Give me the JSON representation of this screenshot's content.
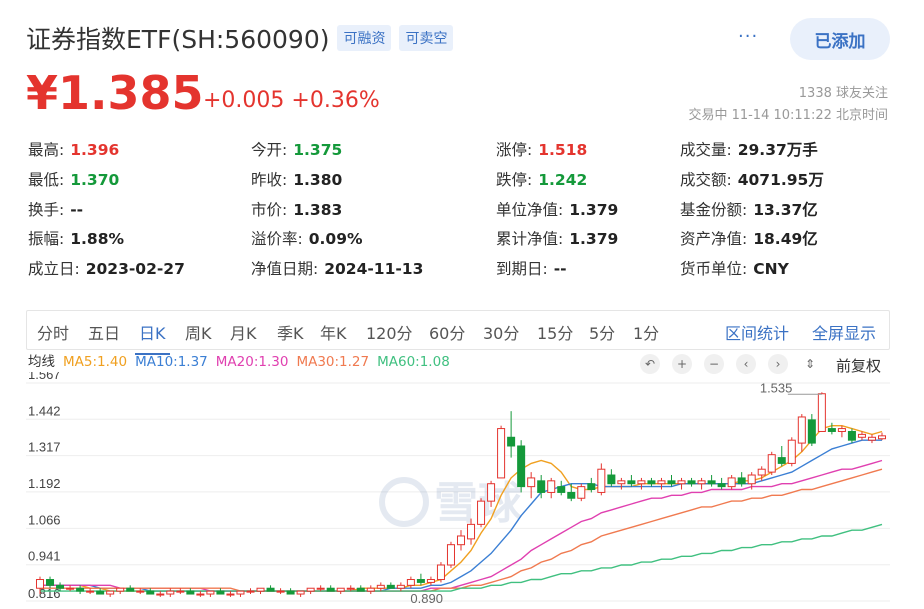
{
  "header": {
    "title": "证券指数ETF(SH:560090)",
    "tags": [
      "可融资",
      "可卖空"
    ],
    "more": "···",
    "added_label": "已添加"
  },
  "quote": {
    "price": "¥1.385",
    "change": "+0.005 +0.36%",
    "followers": "1338 球友关注",
    "trade_info": "交易中 11-14 10:11:22 北京时间"
  },
  "stats": [
    {
      "k": "最高:",
      "v": "1.396",
      "color": "red"
    },
    {
      "k": "今开:",
      "v": "1.375",
      "color": "green"
    },
    {
      "k": "涨停:",
      "v": "1.518",
      "color": "red"
    },
    {
      "k": "成交量:",
      "v": "29.37万手",
      "color": "dark"
    },
    {
      "k": "最低:",
      "v": "1.370",
      "color": "green"
    },
    {
      "k": "昨收:",
      "v": "1.380",
      "color": "dark"
    },
    {
      "k": "跌停:",
      "v": "1.242",
      "color": "green"
    },
    {
      "k": "成交额:",
      "v": "4071.95万",
      "color": "dark"
    },
    {
      "k": "换手:",
      "v": "--",
      "color": "dark"
    },
    {
      "k": "市价:",
      "v": "1.383",
      "color": "dark"
    },
    {
      "k": "单位净值:",
      "v": "1.379",
      "color": "dark"
    },
    {
      "k": "基金份额:",
      "v": "13.37亿",
      "color": "dark"
    },
    {
      "k": "振幅:",
      "v": "1.88%",
      "color": "dark"
    },
    {
      "k": "溢价率:",
      "v": "0.09%",
      "color": "dark"
    },
    {
      "k": "累计净值:",
      "v": "1.379",
      "color": "dark"
    },
    {
      "k": "资产净值:",
      "v": "18.49亿",
      "color": "dark"
    },
    {
      "k": "成立日:",
      "v": "2023-02-27",
      "color": "dark"
    },
    {
      "k": "净值日期:",
      "v": "2024-11-13",
      "color": "dark"
    },
    {
      "k": "到期日:",
      "v": "--",
      "color": "dark"
    },
    {
      "k": "货币单位:",
      "v": "CNY",
      "color": "dark"
    }
  ],
  "tabs": [
    "分时",
    "五日",
    "日K",
    "周K",
    "月K",
    "季K",
    "年K",
    "120分",
    "60分",
    "30分",
    "15分",
    "5分",
    "1分"
  ],
  "active_tab": "日K",
  "tab_links": [
    "区间统计",
    "全屏显示"
  ],
  "legend": [
    {
      "text": "均线",
      "color": "#333333"
    },
    {
      "text": "MA5:1.40",
      "color": "#f0a020"
    },
    {
      "text": "MA10:1.37",
      "color": "#3b7fd4"
    },
    {
      "text": "MA20:1.30",
      "color": "#e040b0"
    },
    {
      "text": "MA30:1.27",
      "color": "#f07a50"
    },
    {
      "text": "MA60:1.08",
      "color": "#40c080"
    }
  ],
  "controls": [
    "↶",
    "+",
    "−",
    "‹",
    "›",
    "⇕"
  ],
  "fuquan_label": "前复权",
  "watermark": "雪球",
  "chart_data": {
    "type": "candlestick",
    "y_ticks": [
      "1.567",
      "1.442",
      "1.317",
      "1.192",
      "1.066",
      "0.941",
      "0.816"
    ],
    "ylim": [
      0.816,
      1.567
    ],
    "annotations": [
      {
        "text": "1.535"
      },
      {
        "text": "0.890"
      }
    ],
    "candles": [
      {
        "o": 0.86,
        "h": 0.9,
        "l": 0.84,
        "c": 0.89
      },
      {
        "o": 0.89,
        "h": 0.9,
        "l": 0.86,
        "c": 0.87
      },
      {
        "o": 0.87,
        "h": 0.88,
        "l": 0.85,
        "c": 0.86
      },
      {
        "o": 0.86,
        "h": 0.87,
        "l": 0.85,
        "c": 0.86
      },
      {
        "o": 0.86,
        "h": 0.87,
        "l": 0.84,
        "c": 0.85
      },
      {
        "o": 0.85,
        "h": 0.86,
        "l": 0.84,
        "c": 0.85
      },
      {
        "o": 0.85,
        "h": 0.86,
        "l": 0.84,
        "c": 0.84
      },
      {
        "o": 0.84,
        "h": 0.85,
        "l": 0.83,
        "c": 0.85
      },
      {
        "o": 0.85,
        "h": 0.86,
        "l": 0.84,
        "c": 0.86
      },
      {
        "o": 0.86,
        "h": 0.87,
        "l": 0.85,
        "c": 0.85
      },
      {
        "o": 0.85,
        "h": 0.86,
        "l": 0.84,
        "c": 0.85
      },
      {
        "o": 0.85,
        "h": 0.86,
        "l": 0.84,
        "c": 0.84
      },
      {
        "o": 0.84,
        "h": 0.85,
        "l": 0.83,
        "c": 0.84
      },
      {
        "o": 0.84,
        "h": 0.86,
        "l": 0.83,
        "c": 0.85
      },
      {
        "o": 0.85,
        "h": 0.86,
        "l": 0.84,
        "c": 0.85
      },
      {
        "o": 0.85,
        "h": 0.86,
        "l": 0.84,
        "c": 0.84
      },
      {
        "o": 0.84,
        "h": 0.85,
        "l": 0.83,
        "c": 0.84
      },
      {
        "o": 0.84,
        "h": 0.85,
        "l": 0.83,
        "c": 0.85
      },
      {
        "o": 0.85,
        "h": 0.86,
        "l": 0.84,
        "c": 0.84
      },
      {
        "o": 0.84,
        "h": 0.85,
        "l": 0.83,
        "c": 0.84
      },
      {
        "o": 0.84,
        "h": 0.85,
        "l": 0.83,
        "c": 0.85
      },
      {
        "o": 0.85,
        "h": 0.86,
        "l": 0.84,
        "c": 0.85
      },
      {
        "o": 0.85,
        "h": 0.86,
        "l": 0.84,
        "c": 0.86
      },
      {
        "o": 0.86,
        "h": 0.87,
        "l": 0.85,
        "c": 0.85
      },
      {
        "o": 0.85,
        "h": 0.86,
        "l": 0.84,
        "c": 0.85
      },
      {
        "o": 0.85,
        "h": 0.86,
        "l": 0.84,
        "c": 0.84
      },
      {
        "o": 0.84,
        "h": 0.85,
        "l": 0.83,
        "c": 0.85
      },
      {
        "o": 0.85,
        "h": 0.86,
        "l": 0.84,
        "c": 0.86
      },
      {
        "o": 0.86,
        "h": 0.87,
        "l": 0.85,
        "c": 0.86
      },
      {
        "o": 0.86,
        "h": 0.87,
        "l": 0.85,
        "c": 0.85
      },
      {
        "o": 0.85,
        "h": 0.86,
        "l": 0.84,
        "c": 0.86
      },
      {
        "o": 0.86,
        "h": 0.87,
        "l": 0.85,
        "c": 0.86
      },
      {
        "o": 0.86,
        "h": 0.87,
        "l": 0.85,
        "c": 0.85
      },
      {
        "o": 0.85,
        "h": 0.87,
        "l": 0.84,
        "c": 0.86
      },
      {
        "o": 0.86,
        "h": 0.88,
        "l": 0.85,
        "c": 0.87
      },
      {
        "o": 0.87,
        "h": 0.88,
        "l": 0.86,
        "c": 0.86
      },
      {
        "o": 0.86,
        "h": 0.88,
        "l": 0.85,
        "c": 0.87
      },
      {
        "o": 0.87,
        "h": 0.9,
        "l": 0.86,
        "c": 0.89
      },
      {
        "o": 0.89,
        "h": 0.91,
        "l": 0.87,
        "c": 0.88
      },
      {
        "o": 0.88,
        "h": 0.9,
        "l": 0.87,
        "c": 0.89
      },
      {
        "o": 0.89,
        "h": 0.95,
        "l": 0.88,
        "c": 0.94
      },
      {
        "o": 0.94,
        "h": 1.02,
        "l": 0.93,
        "c": 1.01
      },
      {
        "o": 1.01,
        "h": 1.06,
        "l": 0.99,
        "c": 1.04
      },
      {
        "o": 1.03,
        "h": 1.1,
        "l": 1.01,
        "c": 1.08
      },
      {
        "o": 1.08,
        "h": 1.17,
        "l": 1.07,
        "c": 1.16
      },
      {
        "o": 1.16,
        "h": 1.23,
        "l": 1.14,
        "c": 1.22
      },
      {
        "o": 1.24,
        "h": 1.42,
        "l": 1.24,
        "c": 1.41
      },
      {
        "o": 1.38,
        "h": 1.47,
        "l": 1.31,
        "c": 1.35
      },
      {
        "o": 1.35,
        "h": 1.37,
        "l": 1.19,
        "c": 1.21
      },
      {
        "o": 1.21,
        "h": 1.26,
        "l": 1.17,
        "c": 1.24
      },
      {
        "o": 1.23,
        "h": 1.25,
        "l": 1.17,
        "c": 1.19
      },
      {
        "o": 1.19,
        "h": 1.24,
        "l": 1.17,
        "c": 1.23
      },
      {
        "o": 1.21,
        "h": 1.23,
        "l": 1.18,
        "c": 1.19
      },
      {
        "o": 1.19,
        "h": 1.22,
        "l": 1.16,
        "c": 1.17
      },
      {
        "o": 1.17,
        "h": 1.22,
        "l": 1.16,
        "c": 1.21
      },
      {
        "o": 1.22,
        "h": 1.24,
        "l": 1.19,
        "c": 1.2
      },
      {
        "o": 1.19,
        "h": 1.29,
        "l": 1.18,
        "c": 1.27
      },
      {
        "o": 1.25,
        "h": 1.27,
        "l": 1.21,
        "c": 1.22
      },
      {
        "o": 1.22,
        "h": 1.24,
        "l": 1.2,
        "c": 1.23
      },
      {
        "o": 1.23,
        "h": 1.25,
        "l": 1.21,
        "c": 1.22
      },
      {
        "o": 1.22,
        "h": 1.24,
        "l": 1.2,
        "c": 1.23
      },
      {
        "o": 1.23,
        "h": 1.24,
        "l": 1.21,
        "c": 1.22
      },
      {
        "o": 1.22,
        "h": 1.24,
        "l": 1.2,
        "c": 1.23
      },
      {
        "o": 1.23,
        "h": 1.25,
        "l": 1.21,
        "c": 1.22
      },
      {
        "o": 1.22,
        "h": 1.24,
        "l": 1.2,
        "c": 1.23
      },
      {
        "o": 1.23,
        "h": 1.24,
        "l": 1.21,
        "c": 1.22
      },
      {
        "o": 1.22,
        "h": 1.24,
        "l": 1.2,
        "c": 1.23
      },
      {
        "o": 1.23,
        "h": 1.25,
        "l": 1.21,
        "c": 1.22
      },
      {
        "o": 1.22,
        "h": 1.24,
        "l": 1.2,
        "c": 1.21
      },
      {
        "o": 1.21,
        "h": 1.25,
        "l": 1.2,
        "c": 1.24
      },
      {
        "o": 1.24,
        "h": 1.26,
        "l": 1.21,
        "c": 1.22
      },
      {
        "o": 1.22,
        "h": 1.26,
        "l": 1.2,
        "c": 1.25
      },
      {
        "o": 1.25,
        "h": 1.28,
        "l": 1.23,
        "c": 1.27
      },
      {
        "o": 1.26,
        "h": 1.33,
        "l": 1.25,
        "c": 1.32
      },
      {
        "o": 1.31,
        "h": 1.35,
        "l": 1.28,
        "c": 1.29
      },
      {
        "o": 1.29,
        "h": 1.38,
        "l": 1.28,
        "c": 1.37
      },
      {
        "o": 1.36,
        "h": 1.46,
        "l": 1.33,
        "c": 1.45
      },
      {
        "o": 1.44,
        "h": 1.46,
        "l": 1.35,
        "c": 1.36
      },
      {
        "o": 1.4,
        "h": 1.535,
        "l": 1.4,
        "c": 1.53
      },
      {
        "o": 1.41,
        "h": 1.43,
        "l": 1.39,
        "c": 1.4
      },
      {
        "o": 1.4,
        "h": 1.42,
        "l": 1.38,
        "c": 1.41
      },
      {
        "o": 1.4,
        "h": 1.41,
        "l": 1.36,
        "c": 1.37
      },
      {
        "o": 1.38,
        "h": 1.4,
        "l": 1.37,
        "c": 1.39
      },
      {
        "o": 1.37,
        "h": 1.39,
        "l": 1.36,
        "c": 1.38
      },
      {
        "o": 1.375,
        "h": 1.396,
        "l": 1.37,
        "c": 1.385
      }
    ],
    "ma": [
      {
        "name": "MA5",
        "color": "#f0a020",
        "values": [
          0.87,
          0.87,
          0.87,
          0.87,
          0.87,
          0.86,
          0.86,
          0.85,
          0.85,
          0.85,
          0.85,
          0.85,
          0.85,
          0.85,
          0.85,
          0.85,
          0.85,
          0.85,
          0.85,
          0.85,
          0.85,
          0.85,
          0.85,
          0.85,
          0.85,
          0.85,
          0.85,
          0.85,
          0.85,
          0.85,
          0.85,
          0.85,
          0.86,
          0.86,
          0.86,
          0.86,
          0.86,
          0.87,
          0.87,
          0.88,
          0.89,
          0.92,
          0.95,
          0.99,
          1.05,
          1.1,
          1.18,
          1.24,
          1.27,
          1.29,
          1.3,
          1.29,
          1.26,
          1.21,
          1.2,
          1.2,
          1.21,
          1.21,
          1.21,
          1.21,
          1.22,
          1.22,
          1.22,
          1.22,
          1.22,
          1.22,
          1.22,
          1.22,
          1.22,
          1.22,
          1.23,
          1.23,
          1.24,
          1.26,
          1.28,
          1.3,
          1.33,
          1.37,
          1.41,
          1.42,
          1.42,
          1.41,
          1.4,
          1.39,
          1.4
        ]
      },
      {
        "name": "MA10",
        "color": "#3b7fd4",
        "values": [
          0.87,
          0.87,
          0.87,
          0.87,
          0.87,
          0.87,
          0.86,
          0.86,
          0.86,
          0.86,
          0.86,
          0.85,
          0.85,
          0.85,
          0.85,
          0.85,
          0.85,
          0.85,
          0.85,
          0.85,
          0.85,
          0.85,
          0.85,
          0.85,
          0.85,
          0.85,
          0.85,
          0.85,
          0.85,
          0.85,
          0.85,
          0.85,
          0.85,
          0.85,
          0.85,
          0.86,
          0.86,
          0.86,
          0.86,
          0.87,
          0.87,
          0.88,
          0.9,
          0.92,
          0.95,
          0.98,
          1.02,
          1.06,
          1.11,
          1.15,
          1.19,
          1.2,
          1.21,
          1.22,
          1.22,
          1.22,
          1.21,
          1.21,
          1.21,
          1.21,
          1.21,
          1.21,
          1.21,
          1.21,
          1.22,
          1.22,
          1.22,
          1.22,
          1.22,
          1.22,
          1.22,
          1.22,
          1.23,
          1.24,
          1.25,
          1.26,
          1.28,
          1.3,
          1.32,
          1.34,
          1.35,
          1.36,
          1.37,
          1.37,
          1.37
        ]
      },
      {
        "name": "MA20",
        "color": "#e040b0",
        "values": [
          0.87,
          0.87,
          0.87,
          0.87,
          0.87,
          0.87,
          0.87,
          0.87,
          0.86,
          0.86,
          0.86,
          0.86,
          0.86,
          0.86,
          0.86,
          0.86,
          0.86,
          0.85,
          0.85,
          0.85,
          0.85,
          0.85,
          0.85,
          0.85,
          0.85,
          0.85,
          0.85,
          0.85,
          0.85,
          0.85,
          0.85,
          0.85,
          0.85,
          0.85,
          0.85,
          0.85,
          0.85,
          0.85,
          0.85,
          0.86,
          0.86,
          0.86,
          0.87,
          0.88,
          0.89,
          0.9,
          0.92,
          0.94,
          0.96,
          0.99,
          1.01,
          1.03,
          1.05,
          1.07,
          1.09,
          1.1,
          1.12,
          1.13,
          1.14,
          1.15,
          1.16,
          1.17,
          1.17,
          1.18,
          1.18,
          1.19,
          1.19,
          1.2,
          1.2,
          1.2,
          1.2,
          1.21,
          1.21,
          1.21,
          1.22,
          1.22,
          1.23,
          1.24,
          1.25,
          1.26,
          1.27,
          1.27,
          1.28,
          1.29,
          1.3
        ]
      },
      {
        "name": "MA30",
        "color": "#f07a50",
        "values": [
          0.86,
          0.86,
          0.86,
          0.86,
          0.86,
          0.86,
          0.86,
          0.86,
          0.86,
          0.86,
          0.86,
          0.86,
          0.86,
          0.86,
          0.86,
          0.86,
          0.86,
          0.86,
          0.86,
          0.86,
          0.85,
          0.85,
          0.85,
          0.85,
          0.85,
          0.85,
          0.85,
          0.85,
          0.85,
          0.85,
          0.85,
          0.85,
          0.85,
          0.85,
          0.85,
          0.85,
          0.85,
          0.85,
          0.85,
          0.85,
          0.86,
          0.86,
          0.86,
          0.87,
          0.87,
          0.88,
          0.89,
          0.9,
          0.92,
          0.93,
          0.95,
          0.96,
          0.98,
          0.99,
          1.01,
          1.02,
          1.04,
          1.05,
          1.06,
          1.07,
          1.08,
          1.09,
          1.1,
          1.11,
          1.12,
          1.13,
          1.14,
          1.14,
          1.15,
          1.16,
          1.16,
          1.17,
          1.17,
          1.18,
          1.18,
          1.19,
          1.2,
          1.2,
          1.21,
          1.22,
          1.23,
          1.24,
          1.25,
          1.26,
          1.27
        ]
      },
      {
        "name": "MA60",
        "color": "#40c080",
        "values": [
          0.85,
          0.85,
          0.85,
          0.85,
          0.85,
          0.85,
          0.85,
          0.85,
          0.85,
          0.85,
          0.85,
          0.85,
          0.85,
          0.85,
          0.85,
          0.85,
          0.85,
          0.85,
          0.85,
          0.85,
          0.85,
          0.85,
          0.85,
          0.85,
          0.85,
          0.85,
          0.85,
          0.85,
          0.85,
          0.85,
          0.85,
          0.85,
          0.85,
          0.85,
          0.85,
          0.85,
          0.85,
          0.85,
          0.85,
          0.85,
          0.85,
          0.85,
          0.86,
          0.86,
          0.86,
          0.87,
          0.87,
          0.88,
          0.88,
          0.89,
          0.89,
          0.9,
          0.91,
          0.91,
          0.92,
          0.92,
          0.93,
          0.93,
          0.94,
          0.94,
          0.95,
          0.95,
          0.96,
          0.96,
          0.97,
          0.97,
          0.98,
          0.98,
          0.99,
          0.99,
          1.0,
          1.0,
          1.01,
          1.01,
          1.02,
          1.02,
          1.03,
          1.03,
          1.04,
          1.04,
          1.05,
          1.06,
          1.06,
          1.07,
          1.08
        ]
      }
    ]
  }
}
